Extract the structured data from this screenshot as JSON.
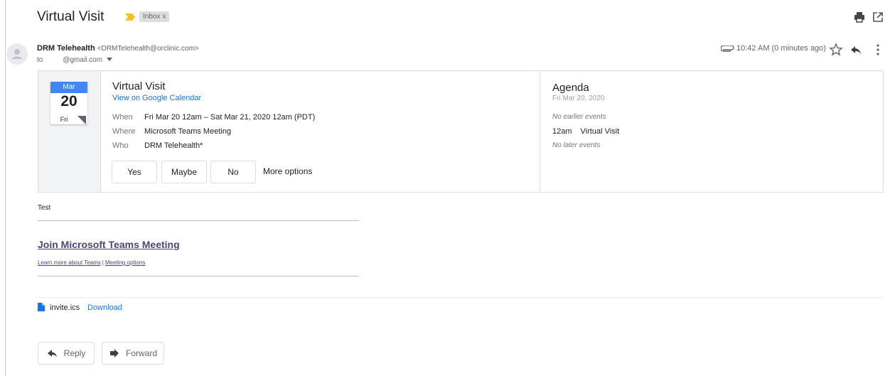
{
  "email": {
    "subject": "Virtual Visit",
    "label_chip": "Inbox",
    "label_chip_close": "x",
    "sender_name": "DRM Telehealth",
    "sender_email": "<DRMTelehealth@orclinic.com>",
    "to_label": "to",
    "to_address": "@gmail.com",
    "time": "10:42 AM (0 minutes ago)"
  },
  "invite": {
    "month": "Mar",
    "day": "20",
    "weekday": "Fri",
    "title": "Virtual Visit",
    "calendar_link": "View on Google Calendar",
    "rows": [
      {
        "label": "When",
        "value": "Fri Mar 20 12am – Sat Mar 21, 2020 12am (PDT)"
      },
      {
        "label": "Where",
        "value": "Microsoft Teams Meeting"
      },
      {
        "label": "Who",
        "value": "DRM Telehealth*"
      }
    ],
    "rsvp": {
      "yes": "Yes",
      "maybe": "Maybe",
      "no": "No",
      "more": "More options"
    }
  },
  "agenda": {
    "title": "Agenda",
    "date": "Fri Mar 20, 2020",
    "no_earlier": "No earlier events",
    "event_time": "12am",
    "event_title": "Virtual Visit",
    "no_later": "No later events"
  },
  "body": {
    "text": "Test",
    "teams_link": "Join Microsoft Teams Meeting",
    "learn_more": "Learn more about Teams",
    "separator": "|",
    "meeting_options": "Meeting options"
  },
  "attachment": {
    "filename": "invite.ics",
    "download": "Download"
  },
  "actions": {
    "reply": "Reply",
    "forward": "Forward"
  },
  "colors": {
    "accent_blue": "#1a73e8",
    "calendar_header": "#4285f4",
    "teams_link": "#464775",
    "importance_marker": "#f6c026"
  },
  "icons": [
    "importance-marker-icon",
    "print-icon",
    "open-new-window-icon",
    "avatar-icon",
    "attachment-clip-icon",
    "star-icon",
    "reply-icon",
    "more-vert-icon",
    "file-icon",
    "reply-arrow-icon",
    "forward-arrow-icon",
    "chevron-down-icon"
  ]
}
